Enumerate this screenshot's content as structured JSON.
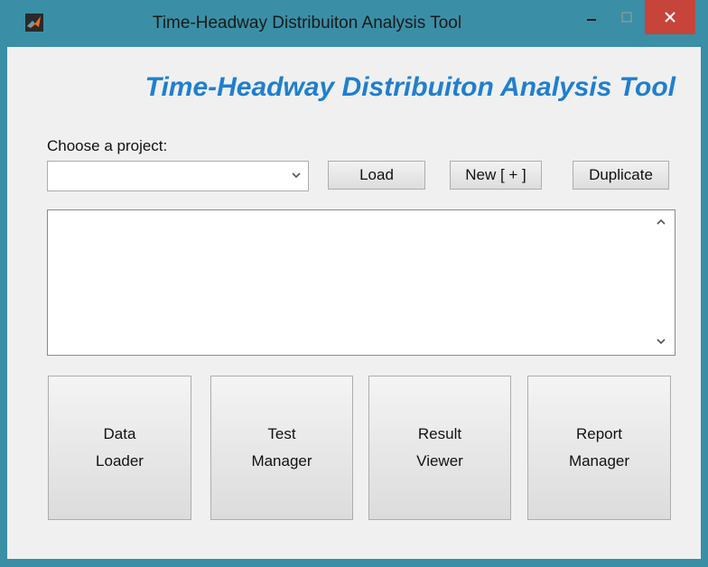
{
  "window": {
    "title": "Time-Headway Distribuiton Analysis Tool",
    "accent_color": "#3a8fa6",
    "close_color": "#c7443a"
  },
  "main": {
    "heading": "Time-Headway Distribuiton Analysis Tool",
    "heading_color": "#1f7fcf",
    "choose_label": "Choose a project:",
    "project_select_value": "",
    "buttons": {
      "load": "Load",
      "new": "New [ + ]",
      "duplicate": "Duplicate"
    },
    "modules": [
      {
        "line1": "Data",
        "line2": "Loader"
      },
      {
        "line1": "Test",
        "line2": "Manager"
      },
      {
        "line1": "Result",
        "line2": "Viewer"
      },
      {
        "line1": "Report",
        "line2": "Manager"
      }
    ]
  },
  "icons": {
    "app": "matlab-logo-icon",
    "minimize": "minimize-icon",
    "maximize": "maximize-icon",
    "close": "close-icon",
    "dropdown": "chevron-down-icon",
    "scroll_up": "chevron-up-icon",
    "scroll_down": "chevron-down-icon"
  }
}
